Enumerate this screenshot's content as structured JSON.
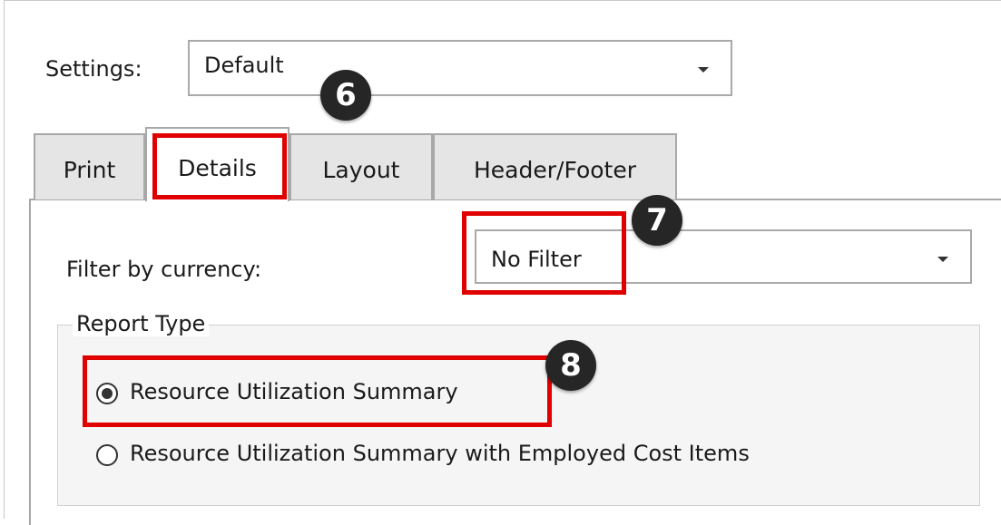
{
  "settings": {
    "label": "Settings:",
    "value": "Default"
  },
  "tabs": [
    {
      "label": "Print",
      "active": false
    },
    {
      "label": "Details",
      "active": true
    },
    {
      "label": "Layout",
      "active": false
    },
    {
      "label": "Header/Footer",
      "active": false
    }
  ],
  "details": {
    "filter_label": "Filter by currency:",
    "filter_value": "No Filter",
    "report_type": {
      "title": "Report Type",
      "options": [
        {
          "label": "Resource Utilization Summary",
          "selected": true
        },
        {
          "label": "Resource Utilization Summary with Employed Cost Items",
          "selected": false
        }
      ]
    }
  },
  "callouts": {
    "settings_step": "6",
    "filter_step": "7",
    "report_step": "8"
  },
  "colors": {
    "highlight": "#e00000",
    "badge": "#262626"
  }
}
